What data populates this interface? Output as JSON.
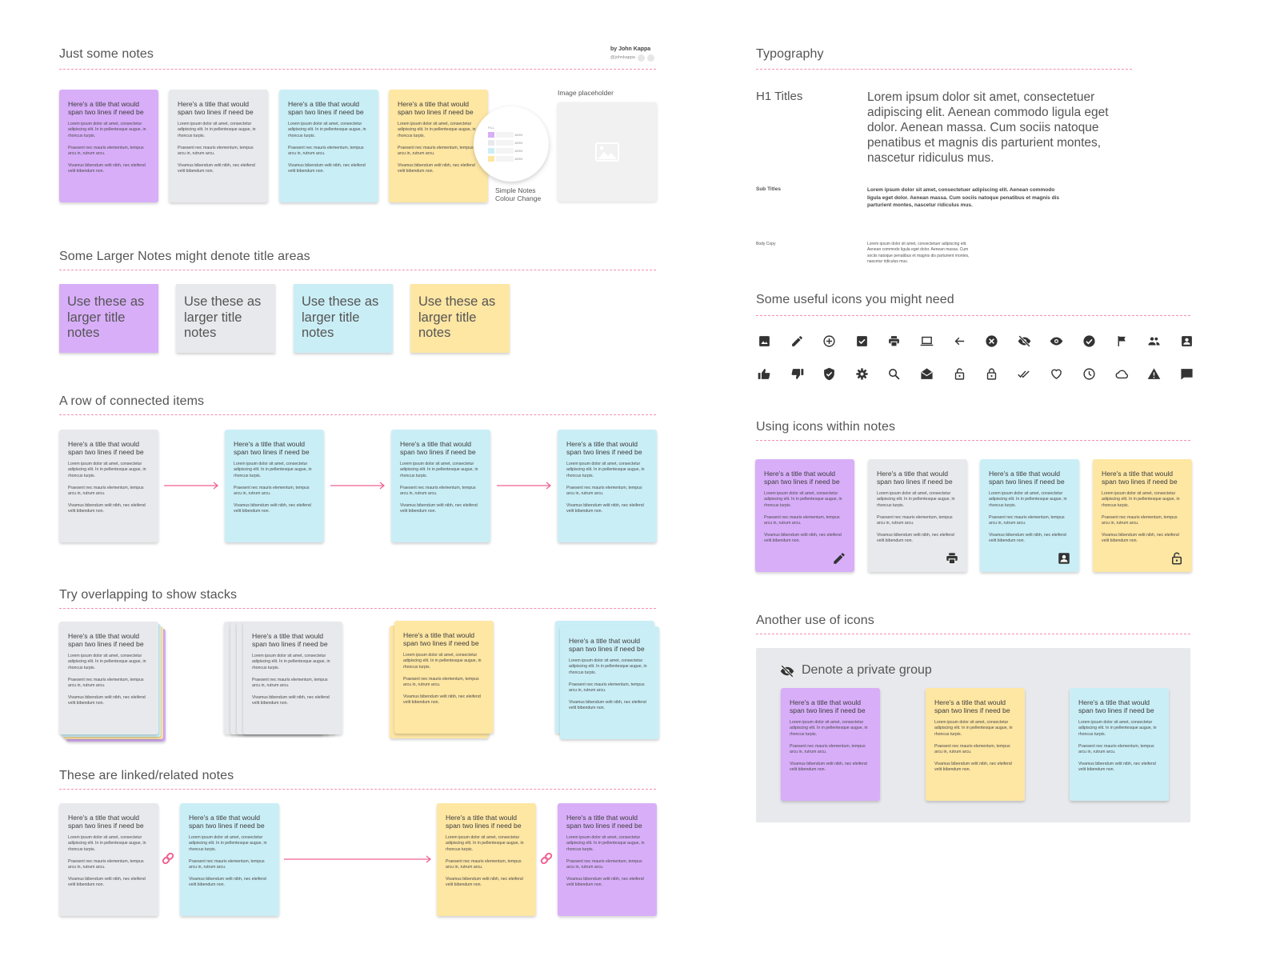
{
  "author": {
    "name": "by John Kappa",
    "handle": "@johnkappa"
  },
  "colors": {
    "purple": "#d8aef9",
    "grey": "#e8e9ec",
    "blue": "#caeef6",
    "yellow": "#fee6a3",
    "accent": "#f06292"
  },
  "note": {
    "title": "Here's a title that would span two lines if need be",
    "p1": "Lorem ipsum dolor sit amet, consectetur adipiscing elit. In in pellentesque augue, in rhoncus turpis.",
    "p2": "Praesent nec mauris elementum, tempus arcu in, rutrum arcu.",
    "p3": "Vivamus bibendum velit nibh, nec eleifend velit bibendum non."
  },
  "sections": {
    "just_notes": {
      "title": "Just some notes",
      "colour_change_label": "Simple Notes Colour Change",
      "fill_panel": {
        "label": "FILL",
        "rows": [
          {
            "swatch": "purple",
            "opacity": "100%"
          },
          {
            "swatch": "grey",
            "opacity": "100%"
          },
          {
            "swatch": "blue",
            "opacity": "100%"
          },
          {
            "swatch": "yellow",
            "opacity": "100%"
          }
        ]
      },
      "image_placeholder_label": "Image placeholder"
    },
    "larger_notes": {
      "title": "Some Larger Notes might denote title areas",
      "text": "Use these as larger title notes"
    },
    "connected": {
      "title": "A row of connected items"
    },
    "stacks": {
      "title": "Try overlapping to show stacks"
    },
    "linked": {
      "title": "These are linked/related notes"
    },
    "typography": {
      "title": "Typography",
      "h1_label": "H1 Titles",
      "h1_text": "Lorem ipsum dolor sit amet, consectetuer adipiscing elit. Aenean commodo ligula eget dolor. Aenean massa. Cum sociis natoque penatibus et magnis dis parturient montes, nascetur ridiculus mus.",
      "sub_label": "Sub Titles",
      "sub_text": "Lorem ipsum dolor sit amet, consectetuer adipiscing elit. Aenean commodo ligula eget dolor. Aenean massa. Cum sociis natoque penatibus et magnis dis parturient montes, nascetur ridiculus mus.",
      "body_label": "Body Copy",
      "body_text": "Lorem ipsum dolor sit amet, consectetuer adipiscing elit. Aenean commodo ligula eget dolor. Aenean massa. Cum sociis natoque penatibus et magnis dis parturient montes, nascetur ridiculus mus."
    },
    "icons": {
      "title": "Some useful icons you might need",
      "row1": [
        "image",
        "pencil",
        "add-circle",
        "checkbox",
        "printer",
        "laptop",
        "arrow-left",
        "cancel",
        "eye-off",
        "eye",
        "check-circle",
        "flag",
        "people",
        "account-box"
      ],
      "row2": [
        "thumb-up",
        "thumb-down",
        "shield-check",
        "gear",
        "search",
        "drafts",
        "lock-open",
        "lock",
        "done-all",
        "heart",
        "clock",
        "cloud",
        "warning",
        "comment"
      ]
    },
    "icons_in_notes": {
      "title": "Using icons within notes",
      "icons": [
        "pencil",
        "printer",
        "account-box",
        "lock-open"
      ]
    },
    "another_use": {
      "title": "Another use of icons",
      "group_label": "Denote a private group"
    }
  }
}
